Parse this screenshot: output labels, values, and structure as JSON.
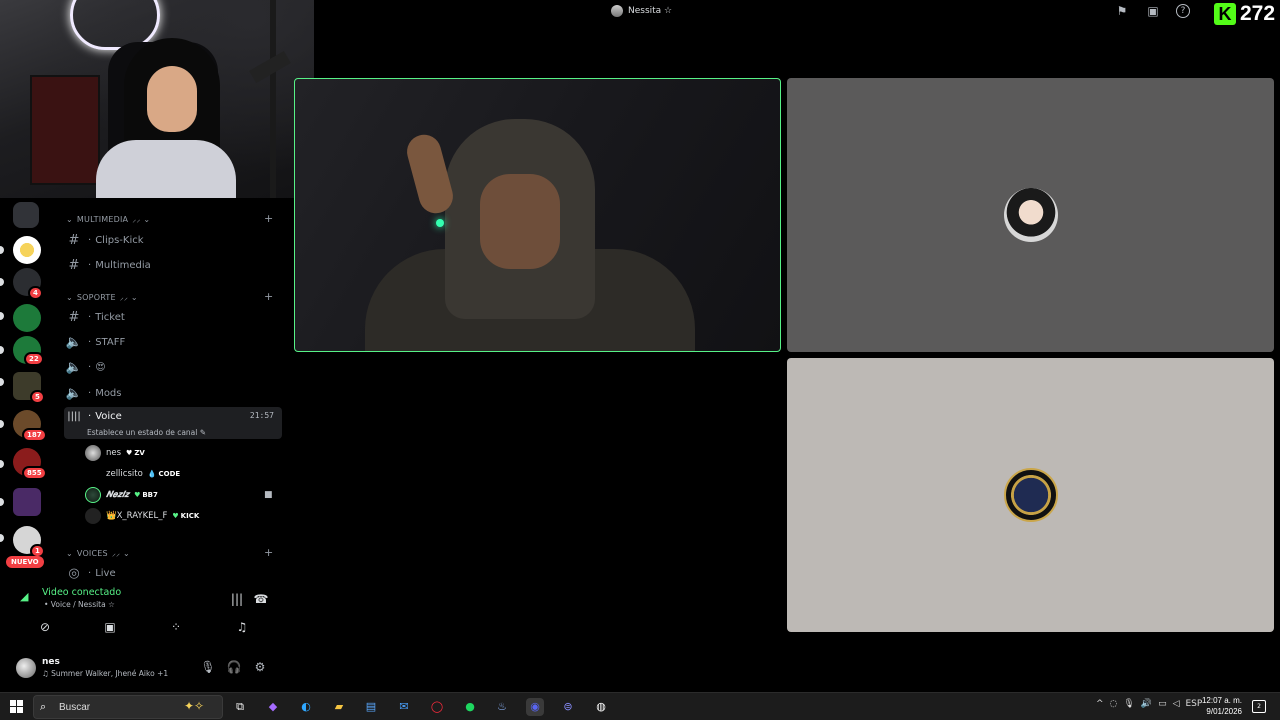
{
  "window": {
    "title": "Nessita ☆"
  },
  "kick": {
    "logo": "K",
    "count": "272"
  },
  "top_icons": [
    "flag-icon",
    "screen-share-icon",
    "help-icon"
  ],
  "rail": {
    "badges": [
      "4",
      "22",
      "5",
      "187",
      "855",
      "1"
    ],
    "new_label": "NUEVO"
  },
  "channels": {
    "categories": [
      {
        "name": "MULTIMEDIA",
        "deco": "⸝⸝ ⌄"
      },
      {
        "name": "SOPORTE",
        "deco": "⸝⸝ ⌄"
      },
      {
        "name": "VOICES",
        "deco": "⸝⸝ ⌄"
      }
    ],
    "items": [
      {
        "prefix": "·",
        "label": "Clips-Kick",
        "icon": "hash-icon"
      },
      {
        "prefix": "·",
        "label": "Multimedia",
        "icon": "hash-icon"
      },
      {
        "prefix": "·",
        "label": "Ticket",
        "icon": "hash-icon"
      },
      {
        "prefix": "·",
        "label": "STAFF",
        "icon": "speaker-lock-icon"
      },
      {
        "prefix": "·",
        "label": "😍",
        "icon": "speaker-icon"
      },
      {
        "prefix": "·",
        "label": "Mods",
        "icon": "speaker-lock-icon"
      },
      {
        "prefix": "·",
        "label": "Voice",
        "icon": "voice-bars-icon",
        "time": "21:57"
      },
      {
        "prefix": "·",
        "label": "Live",
        "icon": "stage-icon"
      }
    ],
    "status_note": "Establece un estado de canal",
    "voice_users": [
      {
        "name": "nes",
        "tag": "ZV"
      },
      {
        "name": "zellicsito",
        "tag": "CODE"
      },
      {
        "name": "𝑵𝒆𝒛𝒍𝒛",
        "tag": "BB7"
      },
      {
        "name": "👑X_RAYKEL_F",
        "tag": "KICK"
      }
    ]
  },
  "voice_panel": {
    "title": "Video conectado",
    "subtitle": "• Voice / Nessita ☆"
  },
  "user_panel": {
    "name": "nes",
    "activity": "♫ Summer Walker, Jhené Aiko +1"
  },
  "taskbar": {
    "search_placeholder": "Buscar",
    "lang": "ESP",
    "time": "12:07 a. m.",
    "date": "9/01/2026",
    "notif_count": "2"
  },
  "colors": {
    "accent_green": "#57f287",
    "kick_green": "#53fc18",
    "badge_red": "#f23f43"
  }
}
